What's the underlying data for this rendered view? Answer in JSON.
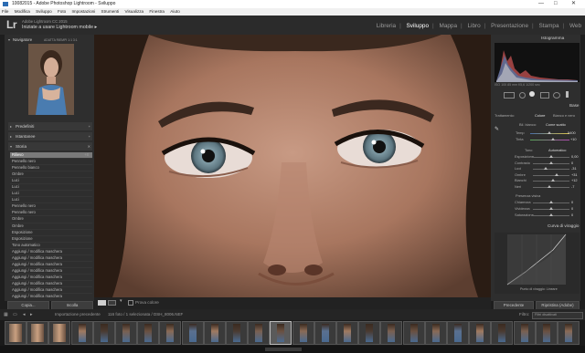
{
  "window": {
    "title": "10082015 - Adobe Photoshop Lightroom - Sviluppo",
    "controls": [
      "—",
      "□",
      "✕"
    ]
  },
  "menu": [
    "File",
    "Modifica",
    "Sviluppo",
    "Foto",
    "Impostazioni",
    "Strumenti",
    "Visualizza",
    "Finestra",
    "Aiuto"
  ],
  "identity": {
    "logo": "Lr",
    "subtitle": "Adobe Lightroom CC 2015",
    "main": "Iniziate a usare Lightroom mobile ▸"
  },
  "modules": [
    {
      "label": "Libreria",
      "active": false
    },
    {
      "label": "Sviluppo",
      "active": true
    },
    {
      "label": "Mappa",
      "active": false
    },
    {
      "label": "Libro",
      "active": false
    },
    {
      "label": "Presentazione",
      "active": false
    },
    {
      "label": "Stampa",
      "active": false
    },
    {
      "label": "Web",
      "active": false
    }
  ],
  "left_panel": {
    "navigator": {
      "label": "Navigatore",
      "zoom_options": "ADATTA  RIEMPI  1:1  3:1"
    },
    "sections": [
      {
        "label": "Predefiniti"
      },
      {
        "label": "Istantanee"
      },
      {
        "label": "Storia"
      }
    ],
    "history": [
      {
        "label": "Rilievo",
        "value": "+8",
        "selected": true
      },
      {
        "label": "Pennello nero",
        "value": "",
        "selected": false
      },
      {
        "label": "Pennello bianco",
        "value": "",
        "selected": false
      },
      {
        "label": "Ombre",
        "value": "",
        "selected": false
      },
      {
        "label": "Luci",
        "value": "",
        "selected": false
      },
      {
        "label": "Luci",
        "value": "",
        "selected": false
      },
      {
        "label": "Luci",
        "value": "",
        "selected": false
      },
      {
        "label": "Luci",
        "value": "",
        "selected": false
      },
      {
        "label": "Pennello nero",
        "value": "",
        "selected": false
      },
      {
        "label": "Pennello nero",
        "value": "",
        "selected": false
      },
      {
        "label": "Ombre",
        "value": "",
        "selected": false
      },
      {
        "label": "Ombre",
        "value": "",
        "selected": false
      },
      {
        "label": "Esposizione",
        "value": "",
        "selected": false
      },
      {
        "label": "Esposizione",
        "value": "",
        "selected": false
      },
      {
        "label": "Tono automatico",
        "value": "",
        "selected": false
      },
      {
        "label": "Aggiungi / modifica maschera",
        "value": "",
        "selected": false
      },
      {
        "label": "Aggiungi / modifica maschera",
        "value": "",
        "selected": false
      },
      {
        "label": "Aggiungi / modifica maschera",
        "value": "",
        "selected": false
      },
      {
        "label": "Aggiungi / modifica maschera",
        "value": "",
        "selected": false
      },
      {
        "label": "Aggiungi / modifica maschera",
        "value": "",
        "selected": false
      },
      {
        "label": "Aggiungi / modifica maschera",
        "value": "",
        "selected": false
      },
      {
        "label": "Aggiungi / modifica maschera",
        "value": "",
        "selected": false
      },
      {
        "label": "Aggiungi / modifica maschera",
        "value": "",
        "selected": false
      },
      {
        "label": "Aggiungi / modifica maschera",
        "value": "",
        "selected": false
      },
      {
        "label": "Aggiungi / modifica maschera",
        "value": "",
        "selected": false
      }
    ],
    "buttons": {
      "copy": "Copia...",
      "paste": "Incolla"
    }
  },
  "toolbar": {
    "soft_proof": "Prova colore"
  },
  "right_panel": {
    "histogram_label": "Istogramma",
    "histogram_readout": "ISO 100   85 mm   f/5,6   1/200 sec",
    "base_label": "Base",
    "treatment": {
      "label": "Trattamento:",
      "color": "Colore",
      "bw": "Bianco e nero"
    },
    "wb": {
      "label": "Bil. bianco:",
      "value": "Come scatto"
    },
    "temp": {
      "label": "Temp",
      "value": "5400"
    },
    "tint": {
      "label": "Tinta",
      "value": "+10"
    },
    "tone": {
      "label": "Tono",
      "auto": "Automatico"
    },
    "sliders": [
      {
        "label": "Esposizione",
        "value": "0,00"
      },
      {
        "label": "Contrasto",
        "value": "0"
      },
      {
        "label": "Luci",
        "value": "-31"
      },
      {
        "label": "Ombre",
        "value": "+31"
      },
      {
        "label": "Bianchi",
        "value": "+12"
      },
      {
        "label": "Neri",
        "value": "-7"
      }
    ],
    "presence_label": "Presenza visiva",
    "presence_sliders": [
      {
        "label": "Chiarezza",
        "value": "0"
      },
      {
        "label": "Vividezza",
        "value": "0"
      },
      {
        "label": "Saturazione",
        "value": "0"
      }
    ],
    "curve_label": "Curva di viraggio",
    "curve_channel": "Punto di viraggio: Lineare",
    "buttons": {
      "previous": "Precedente",
      "reset": "Ripristina (Adobe)"
    }
  },
  "filmstrip": {
    "header_left": "Importazione precedente",
    "header_count": "116 foto / 1 selezionata / DSH_8006.NEF",
    "filter_label": "Filtro:",
    "filter_value": "Filtri disattivati",
    "thumbs": 26
  },
  "colors": {
    "panel_bg": "#2e2e2e",
    "accent_active": "#ffffff",
    "history_selected": "#7a7a7a"
  }
}
